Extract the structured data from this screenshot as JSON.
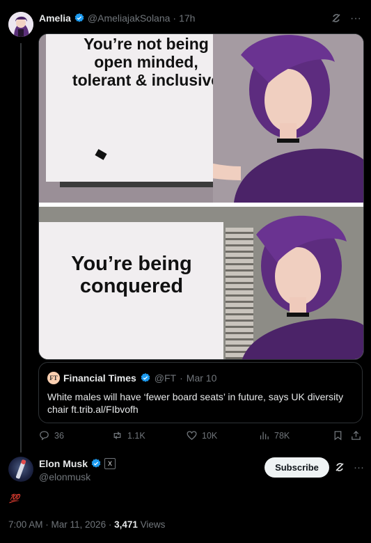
{
  "post": {
    "author_name": "Amelia",
    "author_handle": "@AmeliajakSolana",
    "age": "17h",
    "meme": {
      "top_text": "You’re not being open minded, tolerant & inclusive",
      "bottom_text": "You’re being conquered"
    },
    "quote": {
      "logo_text": "FT",
      "author_name": "Financial Times",
      "author_handle": "@FT",
      "date": "Mar 10",
      "text": "White males will have ‘fewer board seats’ in future, says UK diversity chair ft.trib.al/FIbvofh"
    },
    "stats": {
      "replies": "36",
      "reposts": "1.1K",
      "likes": "10K",
      "views": "78K"
    }
  },
  "reply": {
    "author_name": "Elon Musk",
    "author_handle": "@elonmusk",
    "badge_text": "X",
    "subscribe_label": "Subscribe",
    "content": "💯",
    "time": "7:00 AM · Mar 11, 2026 ·",
    "views_count": "3,471",
    "views_label": "Views"
  },
  "colors": {
    "background": "#000000",
    "verified": "#1d9bf0",
    "muted": "#71767b",
    "text": "#e7e9ea"
  }
}
